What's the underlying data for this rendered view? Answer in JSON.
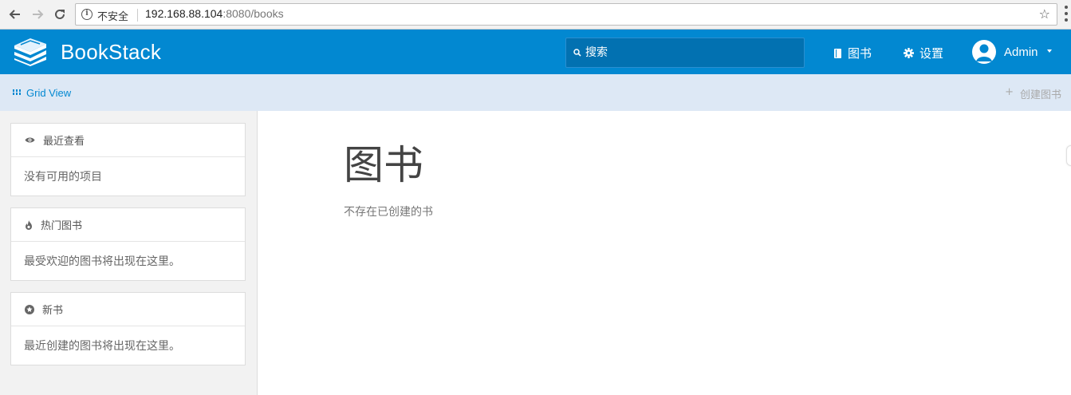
{
  "browser": {
    "security_label": "不安全",
    "url_host": "192.168.88.104",
    "url_rest": ":8080/books",
    "info_glyph": "i",
    "star_glyph": "☆"
  },
  "header": {
    "app_name": "BookStack",
    "search_placeholder": "搜索",
    "nav_books": "图书",
    "nav_settings": "设置",
    "user_name": "Admin",
    "bg_color": "#0288d1"
  },
  "toolbar": {
    "grid_view": "Grid View",
    "create_plus": "+",
    "create_book": "创建图书"
  },
  "sidebar": {
    "recent": {
      "title": "最近查看",
      "body": "没有可用的项目"
    },
    "popular": {
      "title": "热门图书",
      "body": "最受欢迎的图书将出现在这里。"
    },
    "new_books": {
      "title": "新书",
      "body": "最近创建的图书将出现在这里。"
    }
  },
  "main": {
    "title": "图书",
    "empty": "不存在已创建的书"
  }
}
